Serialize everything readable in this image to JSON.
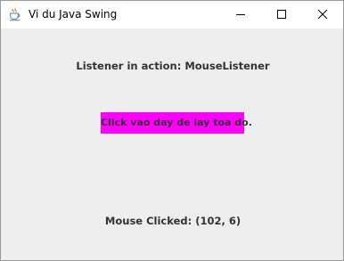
{
  "window": {
    "title": "Vi du Java Swing",
    "icon": "java-coffee-cup-icon"
  },
  "controls": {
    "minimize_icon": "minimize-icon",
    "maximize_icon": "maximize-icon",
    "close_icon": "close-icon"
  },
  "content": {
    "header_label": "Listener in action: MouseListener",
    "click_area_label": "Click vao day de lay toa do.",
    "status_label": "Mouse Clicked: (102, 6)"
  },
  "colors": {
    "panel_background": "#eeeeee",
    "click_area_background": "#ff00ff",
    "label_text": "#333333"
  }
}
